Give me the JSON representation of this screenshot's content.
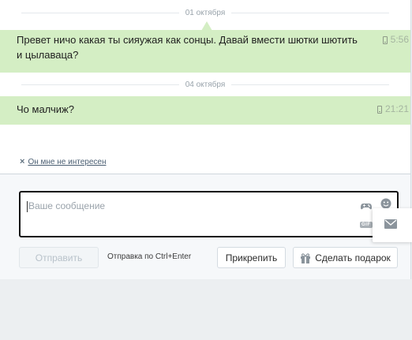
{
  "conversation": {
    "date_dividers": [
      "01 октября",
      "04 октября"
    ],
    "messages": [
      {
        "text_line1": "Превет ничо какая ты сияужая как сонцы. Давай вмести шютки шютить",
        "text_line2": "и цылаваца?",
        "time": "5:56",
        "device_icon": "phone-icon"
      },
      {
        "text_line1": "Чо малчиж?",
        "time": "21:21",
        "device_icon": "phone-icon"
      }
    ],
    "not_interested_label": "Он мне не интересен"
  },
  "composer": {
    "placeholder": "Ваше сообщение",
    "gif_label": "GIF",
    "icons": [
      "gamepad-icon",
      "smile-icon",
      "gif-icon",
      "mail-icon",
      "gift-icon",
      "close-icon"
    ],
    "send_label": "Отправить",
    "hint": "Отправка по Ctrl+Enter",
    "attach_label": "Прикрепить",
    "gift_label": "Сделать подарок"
  },
  "colors": {
    "message_bg": "#d4eec4",
    "composer_bg": "#f6f8fa",
    "page_bg": "#eceff1"
  }
}
